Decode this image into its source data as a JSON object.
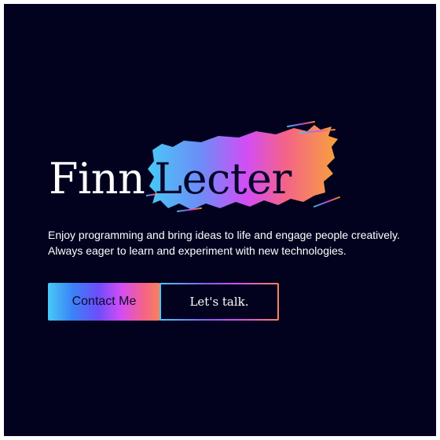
{
  "hero": {
    "first_name": "Finn",
    "last_name": "Lecter",
    "tagline_line1": "Enjoy programming and bring ideas to life and engage people creatively.",
    "tagline_line2": "Always eager to learn and experiment with new technologies."
  },
  "actions": {
    "contact_label": "Contact Me",
    "talk_label": "Let's talk."
  },
  "colors": {
    "background": "#02021f",
    "text": "#ffffff",
    "brush_gradient": [
      "#48c9f6",
      "#6d8cf7",
      "#d24df5",
      "#f4628a",
      "#f7a23a"
    ]
  },
  "icons": {
    "brush": "paint-brush-stroke"
  }
}
